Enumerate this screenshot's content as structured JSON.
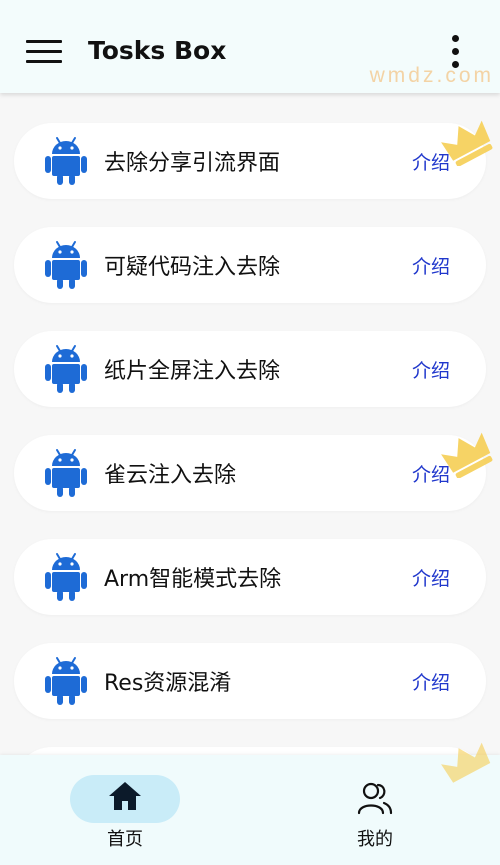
{
  "appbar": {
    "title": "Tosks Box",
    "watermark": "wmdz.com"
  },
  "items": [
    {
      "label": "去除分享引流界面",
      "action": "介绍"
    },
    {
      "label": "可疑代码注入去除",
      "action": "介绍"
    },
    {
      "label": "纸片全屏注入去除",
      "action": "介绍"
    },
    {
      "label": "雀云注入去除",
      "action": "介绍"
    },
    {
      "label": "Arm智能模式去除",
      "action": "介绍"
    },
    {
      "label": "Res资源混淆",
      "action": "介绍"
    }
  ],
  "bottom_nav": {
    "home": "首页",
    "mine": "我的"
  },
  "colors": {
    "android_icon": "#1e6bd6",
    "intro_link": "#2037cc",
    "active_tab_pill": "#c9ecf8"
  }
}
